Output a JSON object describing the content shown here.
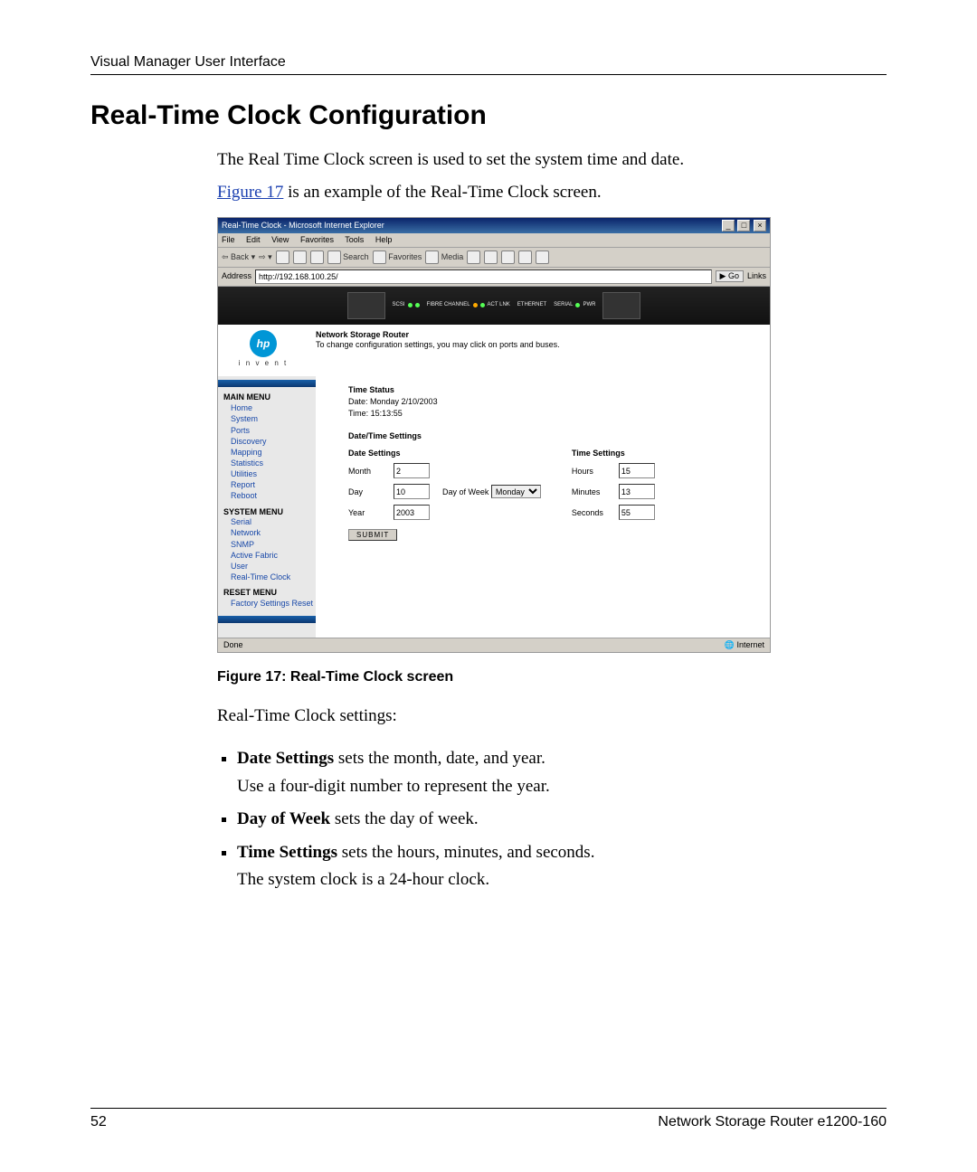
{
  "header": {
    "running": "Visual Manager User Interface"
  },
  "title": "Real-Time Clock Configuration",
  "intro": {
    "p1": "The Real Time Clock screen is used to set the system time and date.",
    "p2_link": "Figure 17",
    "p2_rest": " is an example of the Real-Time Clock screen."
  },
  "ie": {
    "title": "Real-Time Clock - Microsoft Internet Explorer",
    "menus": [
      "File",
      "Edit",
      "View",
      "Favorites",
      "Tools",
      "Help"
    ],
    "toolbar": {
      "back": "Back",
      "search": "Search",
      "favorites": "Favorites",
      "media": "Media"
    },
    "addr_label": "Address",
    "address": "http://192.168.100.25/",
    "go": "Go",
    "links": "Links",
    "status_left": "Done",
    "status_right": "Internet"
  },
  "device": {
    "scsi": "SCSI",
    "fibre": "FIBRE CHANNEL",
    "act": "ACT LNK",
    "eth": "ETHERNET",
    "serial": "SERIAL",
    "pwr": "PWR"
  },
  "brand": {
    "hp": "hp",
    "invent": "i n v e n t"
  },
  "intro_box": {
    "heading": "Network Storage Router",
    "sub": "To change configuration settings, you may click on ports and buses."
  },
  "sidebar": {
    "main_hdr": "MAIN MENU",
    "main": [
      "Home",
      "System",
      "Ports",
      "Discovery",
      "Mapping",
      "Statistics",
      "Utilities",
      "Report",
      "Reboot"
    ],
    "sys_hdr": "SYSTEM MENU",
    "sys": [
      "Serial",
      "Network",
      "SNMP",
      "Active Fabric",
      "User",
      "Real-Time Clock"
    ],
    "reset_hdr": "RESET MENU",
    "reset": [
      "Factory Settings Reset"
    ]
  },
  "panel": {
    "time_status": "Time Status",
    "date_line": "Date: Monday 2/10/2003",
    "time_line": "Time: 15:13:55",
    "dts_hdr": "Date/Time Settings",
    "date_hdr": "Date Settings",
    "time_hdr": "Time Settings",
    "month_l": "Month",
    "month_v": "2",
    "day_l": "Day",
    "day_v": "10",
    "year_l": "Year",
    "year_v": "2003",
    "dow_l": "Day of Week",
    "dow_v": "Monday",
    "hours_l": "Hours",
    "hours_v": "15",
    "min_l": "Minutes",
    "min_v": "13",
    "sec_l": "Seconds",
    "sec_v": "55",
    "submit": "SUBMIT"
  },
  "caption": "Figure 17:  Real-Time Clock screen",
  "settings_intro": "Real-Time Clock settings:",
  "bullets": {
    "b1_bold": "Date Settings",
    "b1_rest": " sets the month, date, and year.",
    "b1_sub": "Use a four-digit number to represent the year.",
    "b2_bold": "Day of Week",
    "b2_rest": " sets the day of week.",
    "b3_bold": "Time Settings",
    "b3_rest": " sets the hours, minutes, and seconds.",
    "b3_sub": "The system clock is a 24-hour clock."
  },
  "footer": {
    "page": "52",
    "doc": "Network Storage Router e1200-160"
  }
}
